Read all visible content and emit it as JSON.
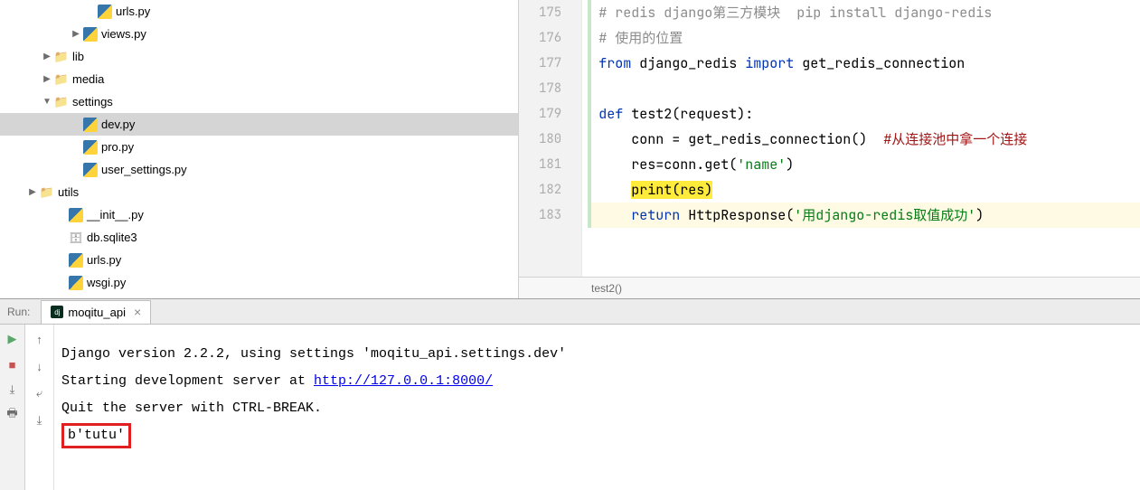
{
  "tree": {
    "items": [
      {
        "indent": 92,
        "arrow": "none",
        "icon": "py",
        "label": "urls.py",
        "selected": false
      },
      {
        "indent": 76,
        "arrow": "right",
        "icon": "py",
        "label": "views.py",
        "selected": false
      },
      {
        "indent": 44,
        "arrow": "right",
        "icon": "folder",
        "label": "lib",
        "selected": false
      },
      {
        "indent": 44,
        "arrow": "right",
        "icon": "folder",
        "label": "media",
        "selected": false
      },
      {
        "indent": 44,
        "arrow": "down",
        "icon": "folder",
        "label": "settings",
        "selected": false
      },
      {
        "indent": 76,
        "arrow": "none",
        "icon": "py",
        "label": "dev.py",
        "selected": true
      },
      {
        "indent": 76,
        "arrow": "none",
        "icon": "py",
        "label": "pro.py",
        "selected": false
      },
      {
        "indent": 76,
        "arrow": "none",
        "icon": "py",
        "label": "user_settings.py",
        "selected": false
      },
      {
        "indent": 28,
        "arrow": "right",
        "icon": "folder",
        "label": "utils",
        "selected": false
      },
      {
        "indent": 60,
        "arrow": "none",
        "icon": "py",
        "label": "__init__.py",
        "selected": false
      },
      {
        "indent": 60,
        "arrow": "none",
        "icon": "db",
        "label": "db.sqlite3",
        "selected": false
      },
      {
        "indent": 60,
        "arrow": "none",
        "icon": "py",
        "label": "urls.py",
        "selected": false
      },
      {
        "indent": 60,
        "arrow": "none",
        "icon": "py",
        "label": "wsgi.py",
        "selected": false
      }
    ]
  },
  "code": {
    "lines": [
      {
        "num": "175",
        "tokens": [
          {
            "t": "# redis django第三方模块  pip install django-redis",
            "c": "comment-zh"
          }
        ]
      },
      {
        "num": "176",
        "tokens": [
          {
            "t": "# 使用的位置",
            "c": "comment-zh"
          }
        ]
      },
      {
        "num": "177",
        "tokens": [
          {
            "t": "from ",
            "c": "kw"
          },
          {
            "t": "django_redis ",
            "c": "ident"
          },
          {
            "t": "import ",
            "c": "kw"
          },
          {
            "t": "get_redis_connection",
            "c": "ident"
          }
        ]
      },
      {
        "num": "178",
        "tokens": []
      },
      {
        "num": "179",
        "tokens": [
          {
            "t": "def ",
            "c": "kw"
          },
          {
            "t": "test2",
            "c": "fn"
          },
          {
            "t": "(request):",
            "c": "ident"
          }
        ]
      },
      {
        "num": "180",
        "tokens": [
          {
            "t": "    conn = get_redis_connection()  ",
            "c": "ident"
          },
          {
            "t": "#从连接池中拿一个连接",
            "c": "comment-red"
          }
        ]
      },
      {
        "num": "181",
        "tokens": [
          {
            "t": "    res=conn.get(",
            "c": "ident"
          },
          {
            "t": "'name'",
            "c": "str"
          },
          {
            "t": ")",
            "c": "ident"
          }
        ]
      },
      {
        "num": "182",
        "highlight": true,
        "tokens": [
          {
            "t": "    ",
            "c": "ident"
          },
          {
            "t": "print(res)",
            "c": "ident",
            "hl": true
          }
        ]
      },
      {
        "num": "183",
        "modified": true,
        "tokens": [
          {
            "t": "    ",
            "c": "ident"
          },
          {
            "t": "return ",
            "c": "kw"
          },
          {
            "t": "HttpResponse(",
            "c": "ident"
          },
          {
            "t": "'用django-redis取值成功'",
            "c": "str"
          },
          {
            "t": ")",
            "c": "ident"
          }
        ]
      },
      {
        "num": "",
        "last": true,
        "tokens": []
      }
    ]
  },
  "crumb": "test2()",
  "run": {
    "label": "Run:",
    "tab_name": "moqitu_api",
    "console_lines": [
      {
        "plain": "Django version 2.2.2, using settings 'moqitu_api.settings.dev'"
      },
      {
        "prefix": "Starting development server at ",
        "link": "http://127.0.0.1:8000/"
      },
      {
        "plain": "Quit the server with CTRL-BREAK."
      },
      {
        "boxed": "b'tutu'"
      }
    ]
  }
}
